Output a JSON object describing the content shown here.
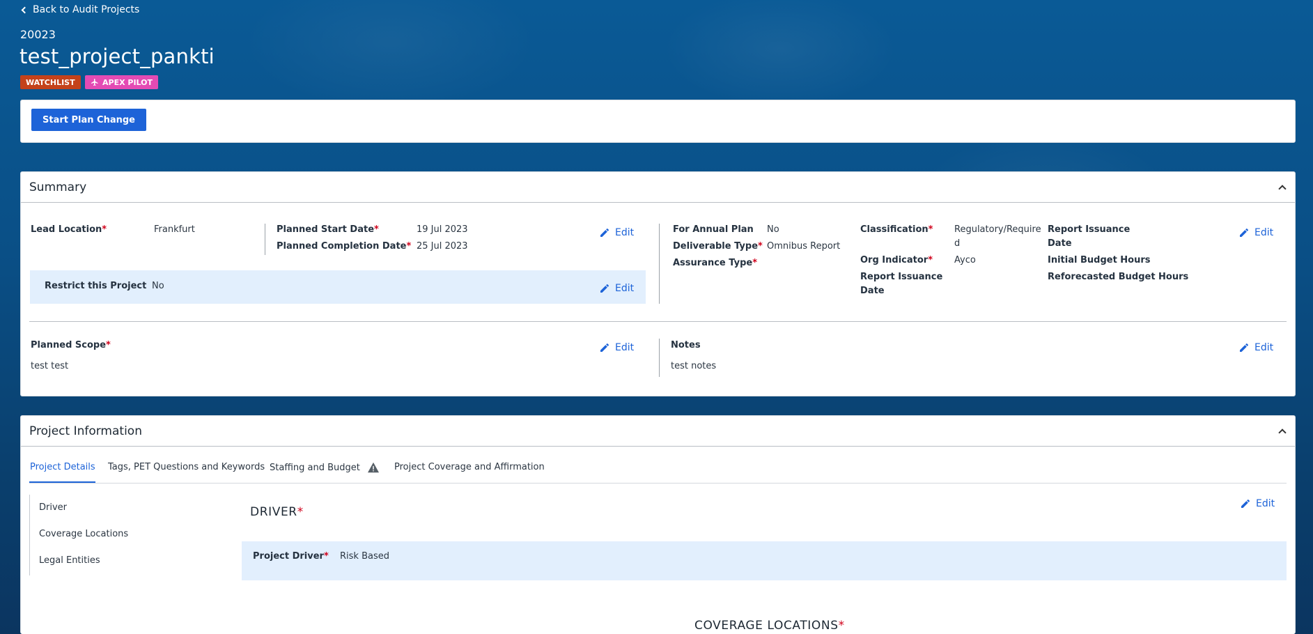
{
  "nav": {
    "back_label": "Back to Audit Projects"
  },
  "project": {
    "number": "20023",
    "title": "test_project_pankti",
    "badges": [
      {
        "label": "WATCHLIST",
        "color": "#c4421b"
      },
      {
        "label": "APEX PILOT",
        "color": "#e44bb4",
        "icon": "airplane-icon"
      }
    ]
  },
  "actions": {
    "start_plan_change": "Start Plan Change"
  },
  "summary": {
    "title": "Summary",
    "lead_location": {
      "label": "Lead Location",
      "value": "Frankfurt"
    },
    "planned_start_date": {
      "label": "Planned Start Date",
      "value": "19 Jul 2023"
    },
    "planned_completion_date": {
      "label": "Planned Completion Date",
      "value": "25 Jul 2023"
    },
    "restrict_project": {
      "label": "Restrict this Project",
      "value": "No"
    },
    "for_annual_plan": {
      "label": "For Annual Plan",
      "value": "No"
    },
    "deliverable_type": {
      "label": "Deliverable Type",
      "value": "Omnibus Report"
    },
    "assurance_type": {
      "label": "Assurance Type",
      "value": ""
    },
    "classification": {
      "label": "Classification",
      "value_line1": "Regulatory/Require",
      "value_line2": "d"
    },
    "org_indicator": {
      "label": "Org Indicator",
      "value": "Ayco"
    },
    "report_issuance_date_mid": {
      "label_line1": "Report Issuance",
      "label_line2": "Date"
    },
    "report_issuance_date_right": {
      "label_line1": "Report Issuance",
      "label_line2": "Date"
    },
    "initial_budget_hours": {
      "label": "Initial Budget Hours"
    },
    "reforecasted_budget_hours": {
      "label": "Reforecasted Budget Hours"
    },
    "planned_scope": {
      "label": "Planned Scope",
      "value": "test test"
    },
    "notes": {
      "label": "Notes",
      "value": "test notes"
    },
    "edit_label": "Edit",
    "required_mark": "*"
  },
  "project_info": {
    "title": "Project Information",
    "tabs": [
      {
        "label": "Project Details",
        "active": true
      },
      {
        "label": "Tags, PET Questions and Keywords"
      },
      {
        "label": "Staffing and Budget",
        "icon": "warning-icon"
      },
      {
        "label": "Project Coverage and Affirmation"
      }
    ],
    "side_nav": [
      "Driver",
      "Coverage Locations",
      "Legal Entities"
    ],
    "driver_section": {
      "title": "DRIVER",
      "field_label": "Project Driver",
      "field_value": "Risk Based"
    },
    "coverage_section": {
      "title": "COVERAGE LOCATIONS"
    },
    "edit_label": "Edit"
  },
  "colors": {
    "accent": "#1d63d8",
    "highlight": "#e2effd",
    "watchlist": "#c4421b",
    "apex": "#e44bb4",
    "required": "#d0021b"
  }
}
